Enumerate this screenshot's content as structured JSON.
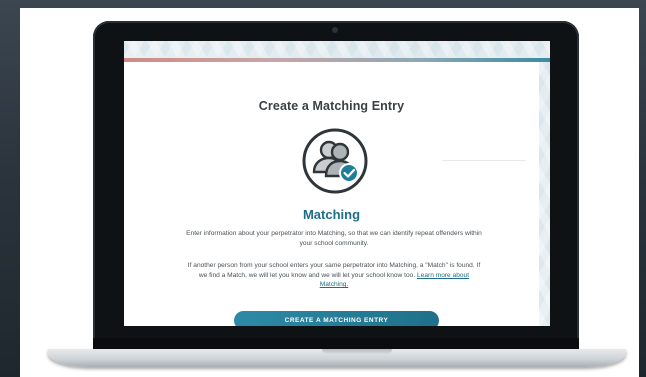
{
  "page": {
    "title": "Create a Matching Entry",
    "section_heading": "Matching",
    "intro_paragraph": "Enter information about your perpetrator into Matching, so that we can identify repeat offenders within your school community.",
    "match_paragraph": "If another person from your school enters your same perpetrator into Matching, a \"Match\" is found. If we find a Match, we will let you know and we will let your school know too.",
    "learn_more_link": "Learn more about Matching.",
    "primary_button_label": "CREATE A MATCHING ENTRY",
    "icon": "people-check-icon"
  },
  "colors": {
    "accent": "#1f6f86",
    "button": "#2482a0",
    "background": "#2b343d"
  }
}
